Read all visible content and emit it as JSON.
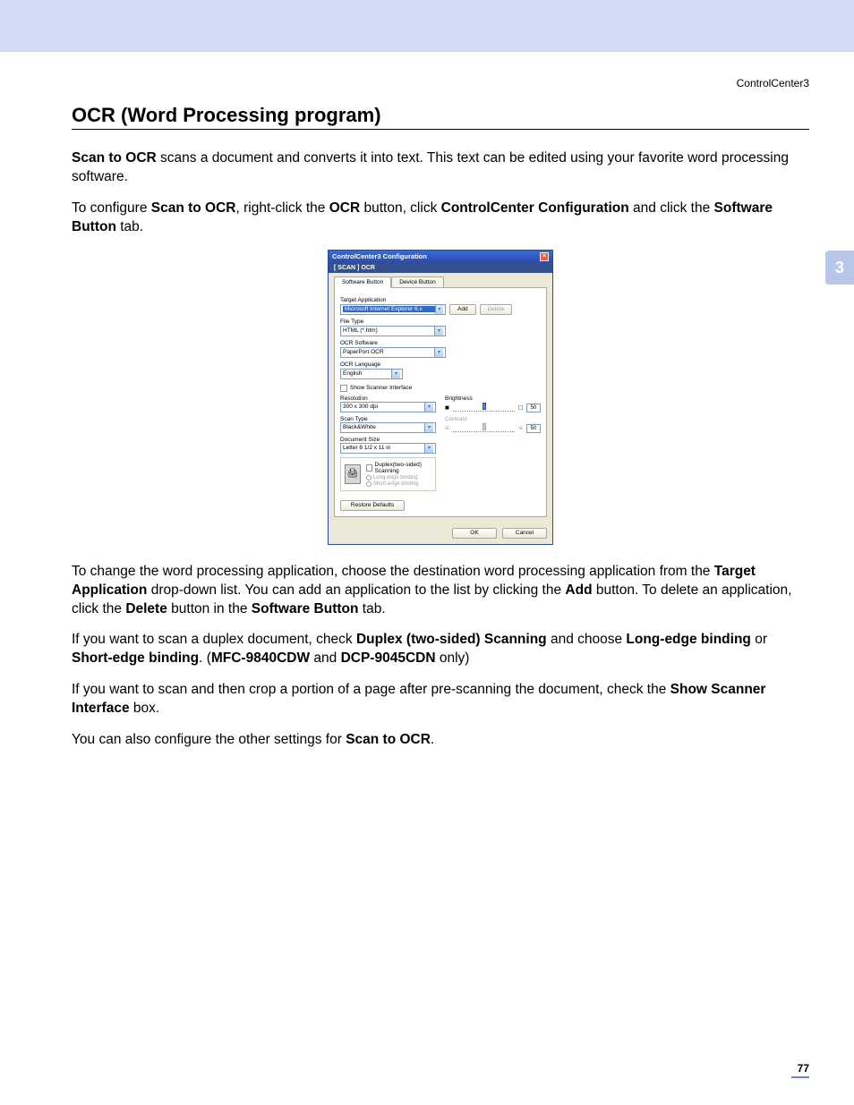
{
  "header": {
    "label": "ControlCenter3"
  },
  "title": "OCR (Word Processing program)",
  "side_tab": "3",
  "page_number": "77",
  "p1": {
    "b1": "Scan to OCR",
    "t1": " scans a document and converts it into text. This text can be edited using your favorite word processing software."
  },
  "p2": {
    "t1": "To configure ",
    "b1": "Scan to OCR",
    "t2": ", right-click the ",
    "b2": "OCR",
    "t3": " button, click ",
    "b3": "ControlCenter Configuration",
    "t4": " and click the ",
    "b4": "Software Button",
    "t5": " tab."
  },
  "p3": {
    "t1": "To change the word processing application, choose the destination word processing application from the ",
    "b1": "Target Application",
    "t2": " drop-down list. You can add an application to the list by clicking the ",
    "b2": "Add",
    "t3": " button. To delete an application, click the ",
    "b3": "Delete",
    "t4": " button in the ",
    "b4": "Software Button",
    "t5": " tab."
  },
  "p4": {
    "t1": "If you want to scan a duplex document, check ",
    "b1": "Duplex (two-sided) Scanning",
    "t2": " and choose ",
    "b2": "Long-edge binding",
    "t3": " or ",
    "b3": "Short-edge binding",
    "t4": ". (",
    "b4": "MFC-9840CDW",
    "t5": " and ",
    "b5": "DCP-9045CDN",
    "t6": " only)"
  },
  "p5": {
    "t1": "If you want to scan and then crop a portion of a page after pre-scanning the document, check the ",
    "b1": "Show Scanner Interface",
    "t2": " box."
  },
  "p6": {
    "t1": "You can also configure the other settings for ",
    "b1": "Scan to OCR",
    "t2": "."
  },
  "dialog": {
    "title": "ControlCenter3 Configuration",
    "subhead": "[ SCAN ]  OCR",
    "tabs": {
      "software": "Software Button",
      "device": "Device Button"
    },
    "labels": {
      "target_app": "Target Application",
      "file_type": "File Type",
      "ocr_software": "OCR Software",
      "ocr_language": "OCR Language",
      "show_scanner": "Show Scanner Interface",
      "resolution": "Resolution",
      "scan_type": "Scan Type",
      "doc_size": "Document Size",
      "brightness": "Brightness",
      "contrast": "Contrast",
      "duplex": "Duplex(two-sided) Scanning",
      "long_edge": "Long-edge binding",
      "short_edge": "Short-edge binding"
    },
    "values": {
      "target_app": "Microsoft Internet Explorer 6.x",
      "file_type": "HTML (*.htm)",
      "ocr_software": "PaperPort OCR",
      "ocr_language": "English",
      "resolution": "300 x 300 dpi",
      "scan_type": "Black&White",
      "doc_size": "Letter 8 1/2 x 11 in",
      "brightness": "50",
      "contrast": "50"
    },
    "buttons": {
      "add": "Add",
      "delete": "Delete",
      "restore": "Restore Defaults",
      "ok": "OK",
      "cancel": "Cancel"
    }
  }
}
